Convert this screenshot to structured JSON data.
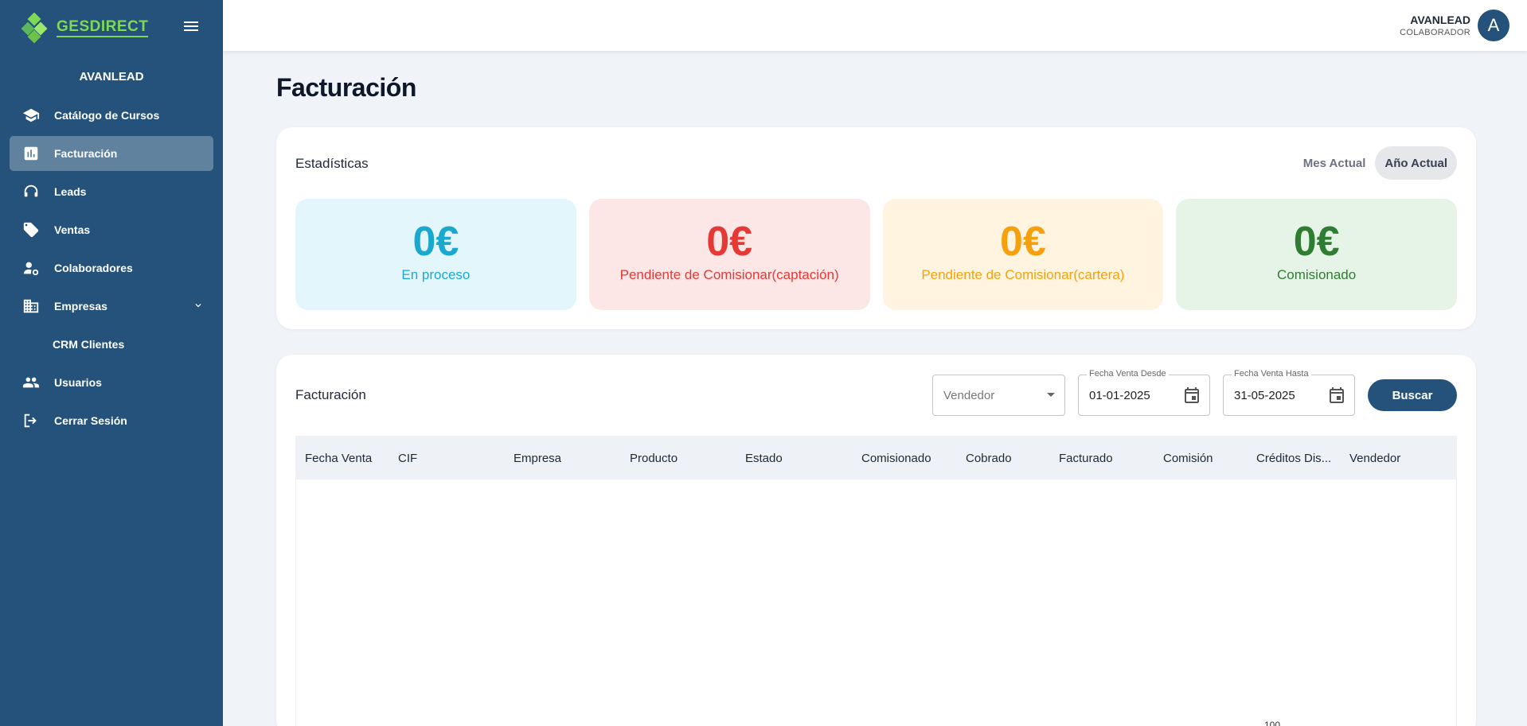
{
  "sidebar": {
    "logo_text": "GESDIRECT",
    "brand_name": "AVANLEAD",
    "items": [
      {
        "label": "Catálogo de Cursos",
        "icon": "school-icon"
      },
      {
        "label": "Facturación",
        "icon": "bar-chart-icon",
        "active": true
      },
      {
        "label": "Leads",
        "icon": "headset-icon"
      },
      {
        "label": "Ventas",
        "icon": "tag-icon"
      },
      {
        "label": "Colaboradores",
        "icon": "people-gear-icon"
      },
      {
        "label": "Empresas",
        "icon": "building-icon",
        "expandable": true
      },
      {
        "label": "CRM Clientes",
        "icon": null,
        "sub": true
      },
      {
        "label": "Usuarios",
        "icon": "group-icon"
      },
      {
        "label": "Cerrar Sesión",
        "icon": "logout-icon"
      }
    ]
  },
  "header": {
    "user_name": "AVANLEAD",
    "user_role": "COLABORADOR",
    "avatar_letter": "A"
  },
  "page": {
    "title": "Facturación"
  },
  "stats": {
    "title": "Estadísticas",
    "periods": [
      "Mes Actual",
      "Año Actual"
    ],
    "active_period": "Año Actual",
    "boxes": [
      {
        "value": "0€",
        "label": "En proceso",
        "color": "#1ba8cf"
      },
      {
        "value": "0€",
        "label": "Pendiente de Comisionar(captación)",
        "color": "#e53935"
      },
      {
        "value": "0€",
        "label": "Pendiente de Comisionar(cartera)",
        "color": "#f5a10e"
      },
      {
        "value": "0€",
        "label": "Comisionado",
        "color": "#2e7d32"
      }
    ]
  },
  "billing": {
    "title": "Facturación",
    "vendor_placeholder": "Vendedor",
    "date_from_label": "Fecha Venta Desde",
    "date_from_value": "01-01-2025",
    "date_to_label": "Fecha Venta Hasta",
    "date_to_value": "31-05-2025",
    "search_label": "Buscar",
    "columns": [
      "Fecha Venta",
      "CIF",
      "Empresa",
      "Producto",
      "Estado",
      "Comisionado",
      "Cobrado",
      "Facturado",
      "Comisión",
      "Créditos Dis...",
      "Vendedor"
    ]
  },
  "colors": {
    "sidebar_bg": "#24527a",
    "accent_green": "#7ed957",
    "page_bg": "#f0f3f8"
  },
  "partial_footer_text": "100"
}
